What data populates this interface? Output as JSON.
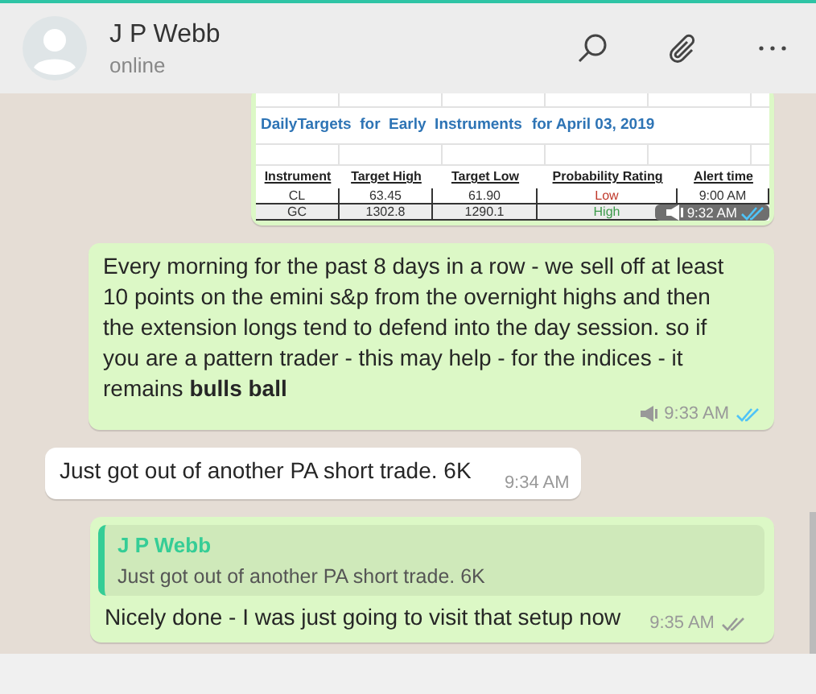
{
  "header": {
    "name": "J P Webb",
    "status": "online"
  },
  "messages": [
    {
      "kind": "image_table",
      "outgoing": true,
      "title": "DailyTargets  for  Early  Instruments",
      "date": "for April 03, 2019",
      "columns": [
        "Instrument",
        "Target High",
        "Target Low",
        "Probability Rating",
        "Alert time"
      ],
      "rows": [
        {
          "cells": [
            "CL",
            "63.45",
            "61.90",
            "Low",
            "9:00 AM"
          ],
          "color": "#c0392b"
        },
        {
          "cells": [
            "GC",
            "1302.8",
            "1290.1",
            "High"
          ],
          "color": "#3c9a4a"
        }
      ],
      "time": "9:32 AM",
      "read": true
    },
    {
      "kind": "text",
      "outgoing": true,
      "text": "Every morning for the past 8 days in a row - we sell off at least 10 points on the emini s&p from the overnight highs and then the extension longs tend to defend into the day session. so if you are a pattern trader - this may help - for the indices - it remains **bulls ball**",
      "time": "9:33 AM",
      "read": true
    },
    {
      "kind": "text",
      "outgoing": false,
      "text": "Just got out of another PA short trade.  6K",
      "time": "9:34 AM"
    },
    {
      "kind": "reply",
      "outgoing": true,
      "quote_author": "J P Webb",
      "quote_text": "Just got out of another PA short trade. 6K",
      "text": "Nicely done - I was just going to visit that setup now",
      "time": "9:35 AM",
      "read": false
    }
  ]
}
